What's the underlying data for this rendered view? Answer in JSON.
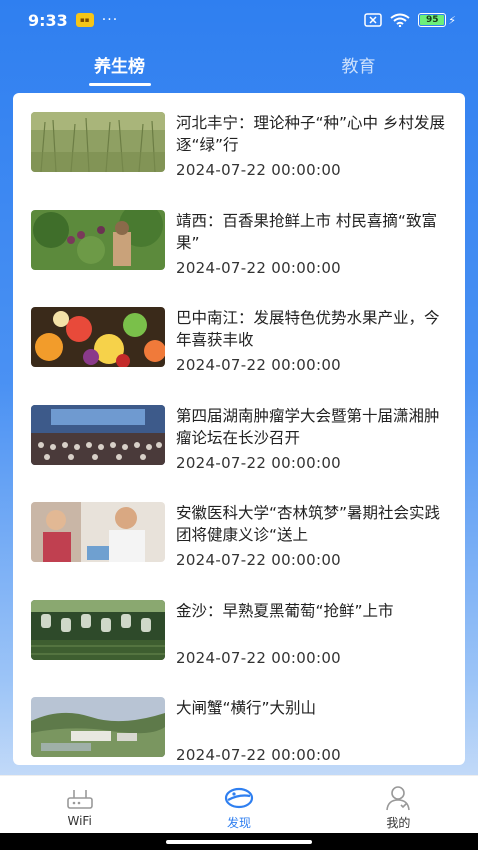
{
  "status": {
    "time": "9:33",
    "dots": "···",
    "battery": "95"
  },
  "tabs": [
    {
      "label": "养生榜",
      "active": true
    },
    {
      "label": "教育",
      "active": false
    }
  ],
  "news": [
    {
      "title": "河北丰宁：理论种子“种”心中 乡村发展逐“绿”行",
      "date": "2024-07-22 00:00:00"
    },
    {
      "title": "靖西：百香果抢鲜上市 村民喜摘“致富果”",
      "date": "2024-07-22 00:00:00"
    },
    {
      "title": "巴中南江：发展特色优势水果产业，今年喜获丰收",
      "date": "2024-07-22 00:00:00"
    },
    {
      "title": "第四届湖南肿瘤学大会暨第十届潇湘肿瘤论坛在长沙召开",
      "date": "2024-07-22 00:00:00"
    },
    {
      "title": "安徽医科大学“杏林筑梦”暑期社会实践团将健康义诊“送上",
      "date": "2024-07-22 00:00:00"
    },
    {
      "title": "金沙：早熟夏黑葡萄“抢鲜”上市",
      "date": "2024-07-22 00:00:00"
    },
    {
      "title": "大闸蟹“横行”大别山",
      "date": "2024-07-22 00:00:00"
    }
  ],
  "nav": [
    {
      "label": "WiFi",
      "icon": "router-icon"
    },
    {
      "label": "发现",
      "icon": "planet-icon",
      "active": true
    },
    {
      "label": "我的",
      "icon": "user-icon"
    }
  ],
  "colors": {
    "accent": "#2f7ff0"
  }
}
